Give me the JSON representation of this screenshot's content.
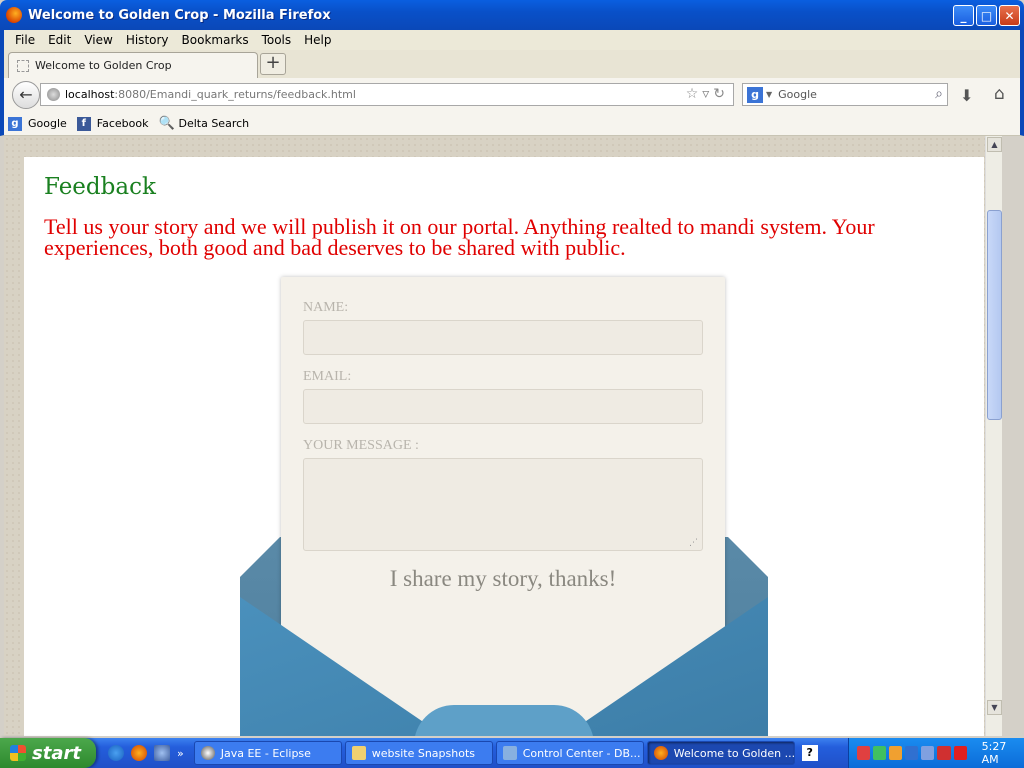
{
  "window": {
    "title": "Welcome to Golden Crop - Mozilla Firefox",
    "buttons": {
      "minimize": "_",
      "maximize": "□",
      "close": "✕"
    }
  },
  "menu": [
    "File",
    "Edit",
    "View",
    "History",
    "Bookmarks",
    "Tools",
    "Help"
  ],
  "tab": {
    "label": "Welcome to Golden Crop",
    "new_tab": "+"
  },
  "nav": {
    "back": "←",
    "url_host": "localhost",
    "url_path": ":8080/Emandi_quark_returns/feedback.html",
    "url_icons": "☆▿↻",
    "search_placeholder": "Google",
    "search_engine_glyph": "g",
    "download": "⬇",
    "home": "⌂"
  },
  "bookmarks": [
    {
      "label": "Google",
      "glyph": "g",
      "icon": "google-icon"
    },
    {
      "label": "Facebook",
      "glyph": "f",
      "icon": "facebook-icon"
    },
    {
      "label": "Delta Search",
      "glyph": "🔍",
      "icon": "delta-search-icon"
    }
  ],
  "page": {
    "title": "Feedback",
    "intro": "Tell us your story and we will publish it on our portal. Anything realted to mandi system. Your experiences, both good and bad deserves to be shared with public.",
    "form": {
      "name_label": "NAME:",
      "email_label": "EMAIL:",
      "message_label": "YOUR MESSAGE :",
      "submit": "I share my story, thanks!"
    }
  },
  "taskbar": {
    "start": "start",
    "more": "»",
    "tasks": [
      {
        "label": "Java EE - Eclipse"
      },
      {
        "label": "website Snapshots"
      },
      {
        "label": "Control Center - DB..."
      },
      {
        "label": "Welcome to Golden ..."
      }
    ],
    "help": "?",
    "clock": "5:27 AM"
  },
  "colors": {
    "title_green": "#1a8020",
    "intro_red": "#e00000",
    "envelope_blue": "#4a90bc",
    "xp_blue": "#0a48b8"
  }
}
